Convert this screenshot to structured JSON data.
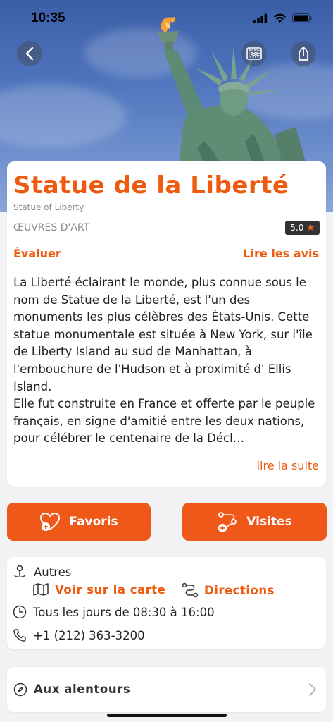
{
  "status_bar": {
    "time": "10:35"
  },
  "header": {
    "back_icon": "chevron-left-icon",
    "stamp_icon": "postcard-stamp-icon",
    "share_icon": "share-icon"
  },
  "place": {
    "title": "Statue de la Liberté",
    "subtitle": "Statue of Liberty",
    "category": "ŒUVRES D'ART",
    "rating": "5.0",
    "rate_label": "Évaluer",
    "reviews_label": "Lire les avis",
    "description": "La Liberté éclairant le monde, plus connue sous le nom de Statue de la Liberté, est l'un des monuments les plus célèbres des États-Unis. Cette statue monumentale est située à New York, sur l'île de Liberty Island au sud de Manhattan, à l'embouchure de l'Hudson et à proximité d' Ellis Island.\nElle fut construite en France et offerte par le peuple français, en signe d'amitié entre les deux nations, pour célébrer le centenaire de la Décl…",
    "read_more": "lire la suite"
  },
  "actions": {
    "favorites_label": "Favoris",
    "visits_label": "Visites"
  },
  "info": {
    "address": "Autres",
    "map_label": "Voir sur la carte",
    "directions_label": "Directions",
    "hours": "Tous les jours de 08:30 à 16:00",
    "phone": "+1 (212) 363-3200"
  },
  "nearby": {
    "label": "Aux alentours"
  },
  "colors": {
    "accent": "#ee5a0e",
    "button": "#f0581a"
  }
}
